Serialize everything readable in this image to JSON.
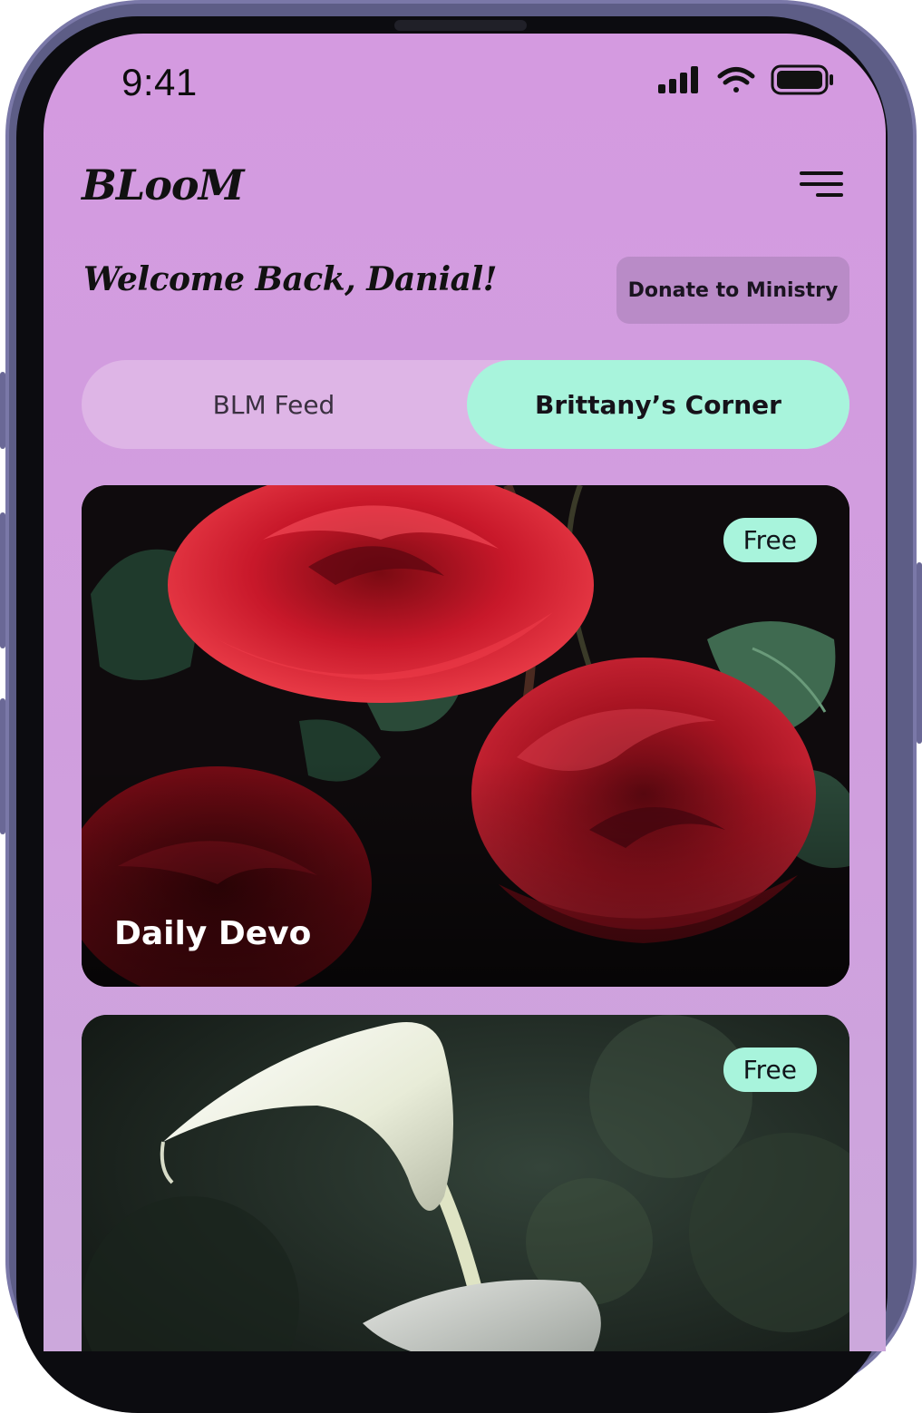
{
  "status_bar": {
    "time": "9:41",
    "icons": [
      "cellular-signal-icon",
      "wifi-icon",
      "battery-icon"
    ]
  },
  "header": {
    "logo": "BLooM",
    "menu_icon": "hamburger-menu-icon"
  },
  "welcome": {
    "greeting": "Welcome Back, Danial!",
    "donate_label": "Donate to Ministry"
  },
  "tabs": [
    {
      "label": "BLM Feed",
      "active": false
    },
    {
      "label": "Brittany’s Corner",
      "active": true
    }
  ],
  "cards": [
    {
      "badge": "Free",
      "title": "Daily Devo",
      "image": "red-roses-image"
    },
    {
      "badge": "Free",
      "title": "",
      "image": "white-calla-lily-image"
    }
  ],
  "colors": {
    "screen_background": "#d49ae0",
    "accent_mint": "#a8f4dc",
    "donate_button": "#b98bc7",
    "tab_track": "#deb5e6"
  }
}
